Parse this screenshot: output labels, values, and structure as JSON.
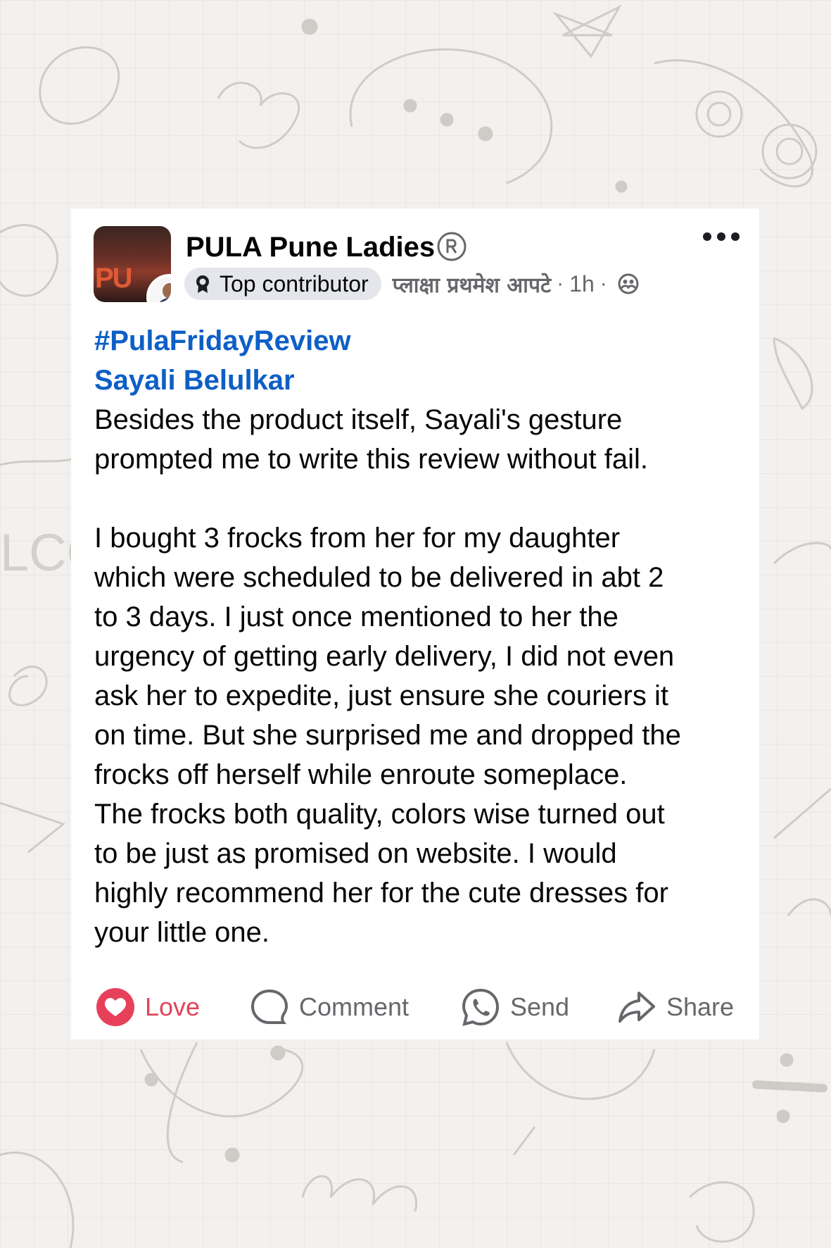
{
  "post": {
    "group_name": "PULA Pune Ladies",
    "badge_label": "Top contributor",
    "author": "प्लाक्षा प्रथमेश आपटे",
    "separator": "·",
    "time": "1h",
    "avatar_logo": "PU",
    "hashtag": "#PulaFridayReview",
    "mention": "Sayali Belulkar",
    "paragraph_1": "Besides the product itself, Sayali's gesture\nprompted me to write this review without fail.",
    "paragraph_2": "I bought 3 frocks from her for my daughter\nwhich were scheduled to be delivered in abt 2\nto 3 days.  I just once mentioned to her the\nurgency of getting early delivery, I did not even\nask her to expedite, just ensure she couriers it\non time. But she surprised me and dropped the\nfrocks off herself while enroute someplace.\nThe frocks both quality, colors wise turned out\nto be just as promised on website. I would\nhighly recommend her for the cute dresses for\nyour little one."
  },
  "icons": {
    "registered": "registered-mark-icon",
    "badge": "award-ribbon-icon",
    "audience": "group-audience-icon",
    "more": "more-options-icon",
    "love": "heart-icon",
    "comment": "comment-bubble-icon",
    "send": "whatsapp-send-icon",
    "share": "share-arrow-icon"
  },
  "actions": {
    "love_label": "Love",
    "comment_label": "Comment",
    "send_label": "Send",
    "share_label": "Share"
  },
  "colors": {
    "link_blue": "#0d5fc6",
    "love_red": "#e0455b",
    "secondary_text": "#65676b",
    "background": "#f3f1ef"
  }
}
